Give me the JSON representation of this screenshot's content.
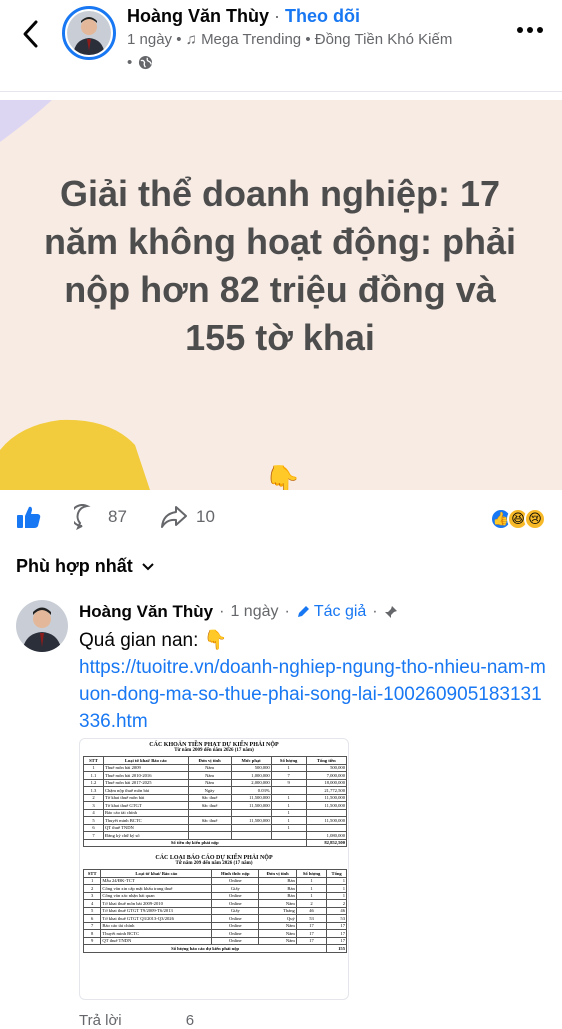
{
  "header": {
    "author": "Hoàng Văn Thùy",
    "separator": "·",
    "follow": "Theo dõi",
    "time": "1 ngày",
    "music": "Mega Trending",
    "song": "Đồng Tiền Khó Kiếm"
  },
  "banner": {
    "title": "Giải thể doanh nghiệp: 17 năm không hoạt động: phải nộp hơn 82 triệu đồng và 155 tờ khai",
    "emoji": "👇"
  },
  "actions": {
    "comments": "87",
    "shares": "10"
  },
  "sort_label": "Phù hợp nhất",
  "comment": {
    "author": "Hoàng Văn Thùy",
    "time": "1 ngày",
    "badge": "Tác giả",
    "text": "Quá gian nan: 👇",
    "link": "https://tuoitre.vn/doanh-nghiep-ngung-tho-nhieu-nam-muon-dong-ma-so-thue-phai-song-lai-100260905183131336.htm"
  },
  "doc": {
    "title1": "CÁC KHOẢN TIỀN PHẠT DỰ KIẾN PHẢI NỘP",
    "sub1": "Từ năm 2009 đến năm 2026 (17 năm)",
    "headers1": [
      "STT",
      "Loại tờ khai/ Báo cáo",
      "Đơn vị tính",
      "Mức phạt",
      "Số lượng",
      "Tổng tiền"
    ],
    "rows1": [
      [
        "1",
        "Thuế môn bài 2009",
        "Năm",
        "500,000",
        "1",
        "500,000"
      ],
      [
        "1.1",
        "Thuế môn bài 2010-2016",
        "Năm",
        "1,000,000",
        "7",
        "7,000,000"
      ],
      [
        "1.2",
        "Thuế môn bài 2017-2025",
        "Năm",
        "2,000,000",
        "9",
        "18,000,000"
      ],
      [
        "1.3",
        "Chậm nộp thuế môn bài",
        "Ngày",
        "0.03%",
        "",
        "21,772,500"
      ],
      [
        "2",
        "Tờ khai thuế môn bài",
        "Sắc thuế",
        "11,500,000",
        "1",
        "11,500,000"
      ],
      [
        "3",
        "Tờ khai thuế GTGT",
        "Sắc thuế",
        "11,500,000",
        "1",
        "11,500,000"
      ],
      [
        "4",
        "Báo cáo tài chính",
        "",
        "",
        "1",
        ""
      ],
      [
        "5",
        "Thuyết minh BCTC",
        "Sắc thuế",
        "11,500,000",
        "1",
        "11,500,000"
      ],
      [
        "6",
        "QT thuế TNDN",
        "",
        "",
        "1",
        ""
      ],
      [
        "7",
        "Đăng ký chữ ký số",
        "",
        "",
        "",
        "1,080,000"
      ]
    ],
    "total1_label": "Số tiền dự kiến phải nộp",
    "total1": "82,852,500",
    "title2": "CÁC LOẠI BÁO CÁO DỰ KIẾN PHẢI NỘP",
    "sub2": "Từ năm 209 đến năm 2026 (17 năm)",
    "headers2": [
      "STT",
      "Loại tờ khai/ Báo cáo",
      "Hình thức nộp",
      "Đơn vị tính",
      "Số lượng",
      "Tổng"
    ],
    "rows2": [
      [
        "1",
        "Mẫu 24/ĐK-TCT",
        "Online",
        "Bản",
        "1",
        "1"
      ],
      [
        "2",
        "Công văn xin cấp mật khẩu trang thuế",
        "Giấy",
        "Bản",
        "1",
        "1"
      ],
      [
        "3",
        "Công văn xác nhận hải quan",
        "Online",
        "Bản",
        "1",
        "1"
      ],
      [
        "4",
        "Tờ khai thuế môn bài 2009-2010",
        "Online",
        "Năm",
        "2",
        "2"
      ],
      [
        "5",
        "Tờ khai thuế GTGT T9/2009-T6/2013",
        "Giấy",
        "Tháng",
        "46",
        "46"
      ],
      [
        "6",
        "Tờ khai thuế GTGT Q3/2013-Q3/2026",
        "Online",
        "Quý",
        "53",
        "53"
      ],
      [
        "7",
        "Báo cáo tài chính",
        "Online",
        "Năm",
        "17",
        "17"
      ],
      [
        "8",
        "Thuyết minh BCTC",
        "Online",
        "Năm",
        "17",
        "17"
      ],
      [
        "9",
        "QT thuế TNDN",
        "Online",
        "Năm",
        "17",
        "17"
      ]
    ],
    "total2_label": "Số lượng báo cáo dự kiến phải nộp",
    "total2": "155"
  },
  "reply": {
    "label": "Trả lời",
    "count": "6"
  },
  "colors": {
    "accent": "#1877f2",
    "banner_bg": "#f8ebe4",
    "title_text": "#4d4d4d"
  }
}
